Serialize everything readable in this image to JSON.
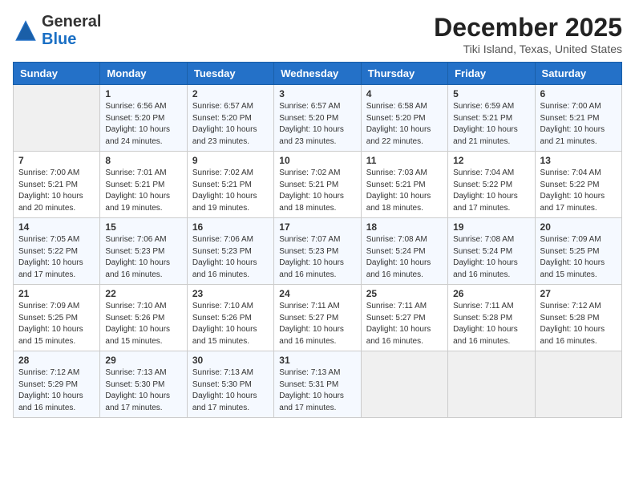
{
  "header": {
    "logo_general": "General",
    "logo_blue": "Blue",
    "month_year": "December 2025",
    "location": "Tiki Island, Texas, United States"
  },
  "days_of_week": [
    "Sunday",
    "Monday",
    "Tuesday",
    "Wednesday",
    "Thursday",
    "Friday",
    "Saturday"
  ],
  "weeks": [
    [
      {
        "day": "",
        "info": ""
      },
      {
        "day": "1",
        "info": "Sunrise: 6:56 AM\nSunset: 5:20 PM\nDaylight: 10 hours\nand 24 minutes."
      },
      {
        "day": "2",
        "info": "Sunrise: 6:57 AM\nSunset: 5:20 PM\nDaylight: 10 hours\nand 23 minutes."
      },
      {
        "day": "3",
        "info": "Sunrise: 6:57 AM\nSunset: 5:20 PM\nDaylight: 10 hours\nand 23 minutes."
      },
      {
        "day": "4",
        "info": "Sunrise: 6:58 AM\nSunset: 5:20 PM\nDaylight: 10 hours\nand 22 minutes."
      },
      {
        "day": "5",
        "info": "Sunrise: 6:59 AM\nSunset: 5:21 PM\nDaylight: 10 hours\nand 21 minutes."
      },
      {
        "day": "6",
        "info": "Sunrise: 7:00 AM\nSunset: 5:21 PM\nDaylight: 10 hours\nand 21 minutes."
      }
    ],
    [
      {
        "day": "7",
        "info": "Sunrise: 7:00 AM\nSunset: 5:21 PM\nDaylight: 10 hours\nand 20 minutes."
      },
      {
        "day": "8",
        "info": "Sunrise: 7:01 AM\nSunset: 5:21 PM\nDaylight: 10 hours\nand 19 minutes."
      },
      {
        "day": "9",
        "info": "Sunrise: 7:02 AM\nSunset: 5:21 PM\nDaylight: 10 hours\nand 19 minutes."
      },
      {
        "day": "10",
        "info": "Sunrise: 7:02 AM\nSunset: 5:21 PM\nDaylight: 10 hours\nand 18 minutes."
      },
      {
        "day": "11",
        "info": "Sunrise: 7:03 AM\nSunset: 5:21 PM\nDaylight: 10 hours\nand 18 minutes."
      },
      {
        "day": "12",
        "info": "Sunrise: 7:04 AM\nSunset: 5:22 PM\nDaylight: 10 hours\nand 17 minutes."
      },
      {
        "day": "13",
        "info": "Sunrise: 7:04 AM\nSunset: 5:22 PM\nDaylight: 10 hours\nand 17 minutes."
      }
    ],
    [
      {
        "day": "14",
        "info": "Sunrise: 7:05 AM\nSunset: 5:22 PM\nDaylight: 10 hours\nand 17 minutes."
      },
      {
        "day": "15",
        "info": "Sunrise: 7:06 AM\nSunset: 5:23 PM\nDaylight: 10 hours\nand 16 minutes."
      },
      {
        "day": "16",
        "info": "Sunrise: 7:06 AM\nSunset: 5:23 PM\nDaylight: 10 hours\nand 16 minutes."
      },
      {
        "day": "17",
        "info": "Sunrise: 7:07 AM\nSunset: 5:23 PM\nDaylight: 10 hours\nand 16 minutes."
      },
      {
        "day": "18",
        "info": "Sunrise: 7:08 AM\nSunset: 5:24 PM\nDaylight: 10 hours\nand 16 minutes."
      },
      {
        "day": "19",
        "info": "Sunrise: 7:08 AM\nSunset: 5:24 PM\nDaylight: 10 hours\nand 16 minutes."
      },
      {
        "day": "20",
        "info": "Sunrise: 7:09 AM\nSunset: 5:25 PM\nDaylight: 10 hours\nand 15 minutes."
      }
    ],
    [
      {
        "day": "21",
        "info": "Sunrise: 7:09 AM\nSunset: 5:25 PM\nDaylight: 10 hours\nand 15 minutes."
      },
      {
        "day": "22",
        "info": "Sunrise: 7:10 AM\nSunset: 5:26 PM\nDaylight: 10 hours\nand 15 minutes."
      },
      {
        "day": "23",
        "info": "Sunrise: 7:10 AM\nSunset: 5:26 PM\nDaylight: 10 hours\nand 15 minutes."
      },
      {
        "day": "24",
        "info": "Sunrise: 7:11 AM\nSunset: 5:27 PM\nDaylight: 10 hours\nand 16 minutes."
      },
      {
        "day": "25",
        "info": "Sunrise: 7:11 AM\nSunset: 5:27 PM\nDaylight: 10 hours\nand 16 minutes."
      },
      {
        "day": "26",
        "info": "Sunrise: 7:11 AM\nSunset: 5:28 PM\nDaylight: 10 hours\nand 16 minutes."
      },
      {
        "day": "27",
        "info": "Sunrise: 7:12 AM\nSunset: 5:28 PM\nDaylight: 10 hours\nand 16 minutes."
      }
    ],
    [
      {
        "day": "28",
        "info": "Sunrise: 7:12 AM\nSunset: 5:29 PM\nDaylight: 10 hours\nand 16 minutes."
      },
      {
        "day": "29",
        "info": "Sunrise: 7:13 AM\nSunset: 5:30 PM\nDaylight: 10 hours\nand 17 minutes."
      },
      {
        "day": "30",
        "info": "Sunrise: 7:13 AM\nSunset: 5:30 PM\nDaylight: 10 hours\nand 17 minutes."
      },
      {
        "day": "31",
        "info": "Sunrise: 7:13 AM\nSunset: 5:31 PM\nDaylight: 10 hours\nand 17 minutes."
      },
      {
        "day": "",
        "info": ""
      },
      {
        "day": "",
        "info": ""
      },
      {
        "day": "",
        "info": ""
      }
    ]
  ]
}
